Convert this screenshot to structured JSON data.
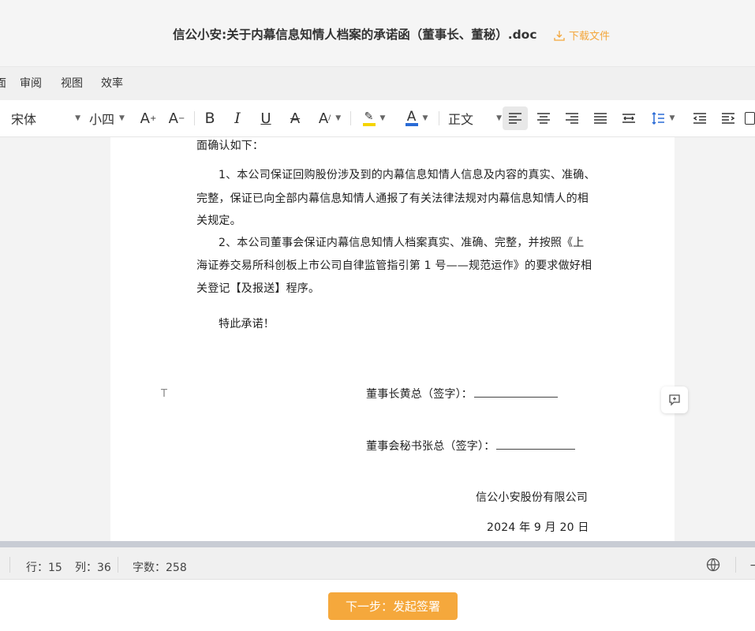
{
  "titlebar": {
    "title": "信公小安:关于内幕信息知情人档案的承诺函（董事长、董秘）.doc",
    "download_label": "下载文件"
  },
  "menu": {
    "items": [
      "审阅",
      "视图",
      "效率"
    ]
  },
  "toolbar": {
    "font_family": "宋体",
    "font_size": "小四",
    "paragraph_style": "正文"
  },
  "document": {
    "lines": [
      "面确认如下：",
      "1、本公司保证回购股份涉及到的内幕信息知情人信息及内容的真实、准确、",
      "完整，保证已向全部内幕信息知情人通报了有关法律法规对内幕信息知情人的相",
      "关规定。",
      "2、本公司董事会保证内幕信息知情人档案真实、准确、完整，并按照《上",
      "海证券交易所科创板上市公司自律监管指引第 1 号——规范运作》的要求做好相",
      "关登记【及报送】程序。",
      "特此承诺！"
    ],
    "chairman_sign": "董事长黄总（签字）：",
    "secretary_sign": "董事会秘书张总（签字）：",
    "company": "信公小安股份有限公司",
    "date": "2024 年 9 月 20 日"
  },
  "status": {
    "row": "行：15",
    "col": "列：36",
    "word_count": "字数：258"
  },
  "footer": {
    "next_label": "下一步：发起签署"
  },
  "colors": {
    "accent": "#f5a83c",
    "highlight": "#f5d400",
    "font_color": "#2a6bd6"
  }
}
